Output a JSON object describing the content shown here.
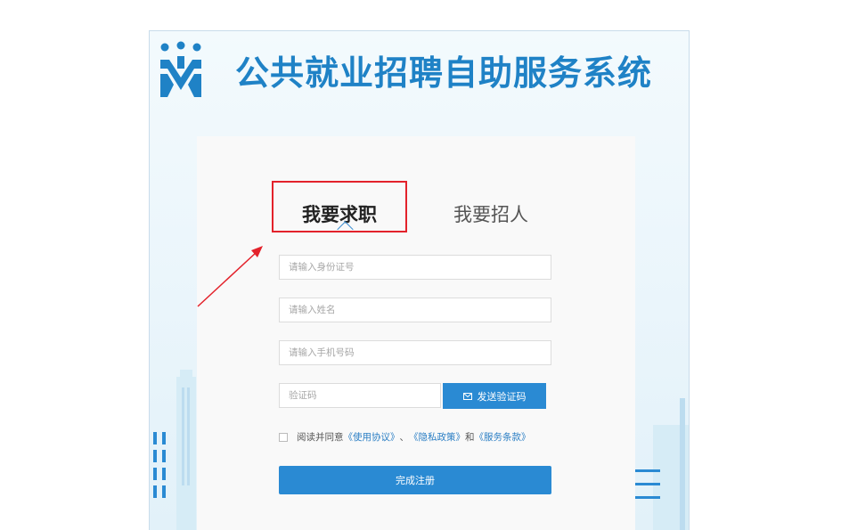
{
  "app": {
    "title": "公共就业招聘自助服务系统"
  },
  "tabs": [
    {
      "label": "我要求职",
      "active": true
    },
    {
      "label": "我要招人",
      "active": false
    }
  ],
  "form": {
    "id_number_placeholder": "请输入身份证号",
    "name_placeholder": "请输入姓名",
    "phone_placeholder": "请输入手机号码",
    "code_placeholder": "验证码",
    "send_code_label": "发送验证码",
    "agree_prefix": "阅读并同意",
    "terms_link": "《使用协议》",
    "separator": "、",
    "privacy_link": "《隐私政策》",
    "and_text": "和",
    "service_link": "《服务条款》",
    "submit_label": "完成注册"
  },
  "colors": {
    "brand": "#1f82c6",
    "button": "#2a8ad3",
    "annotation": "#e3222b"
  },
  "icons": [
    "people-logo-icon",
    "mail-icon",
    "annotation-arrow-icon"
  ]
}
